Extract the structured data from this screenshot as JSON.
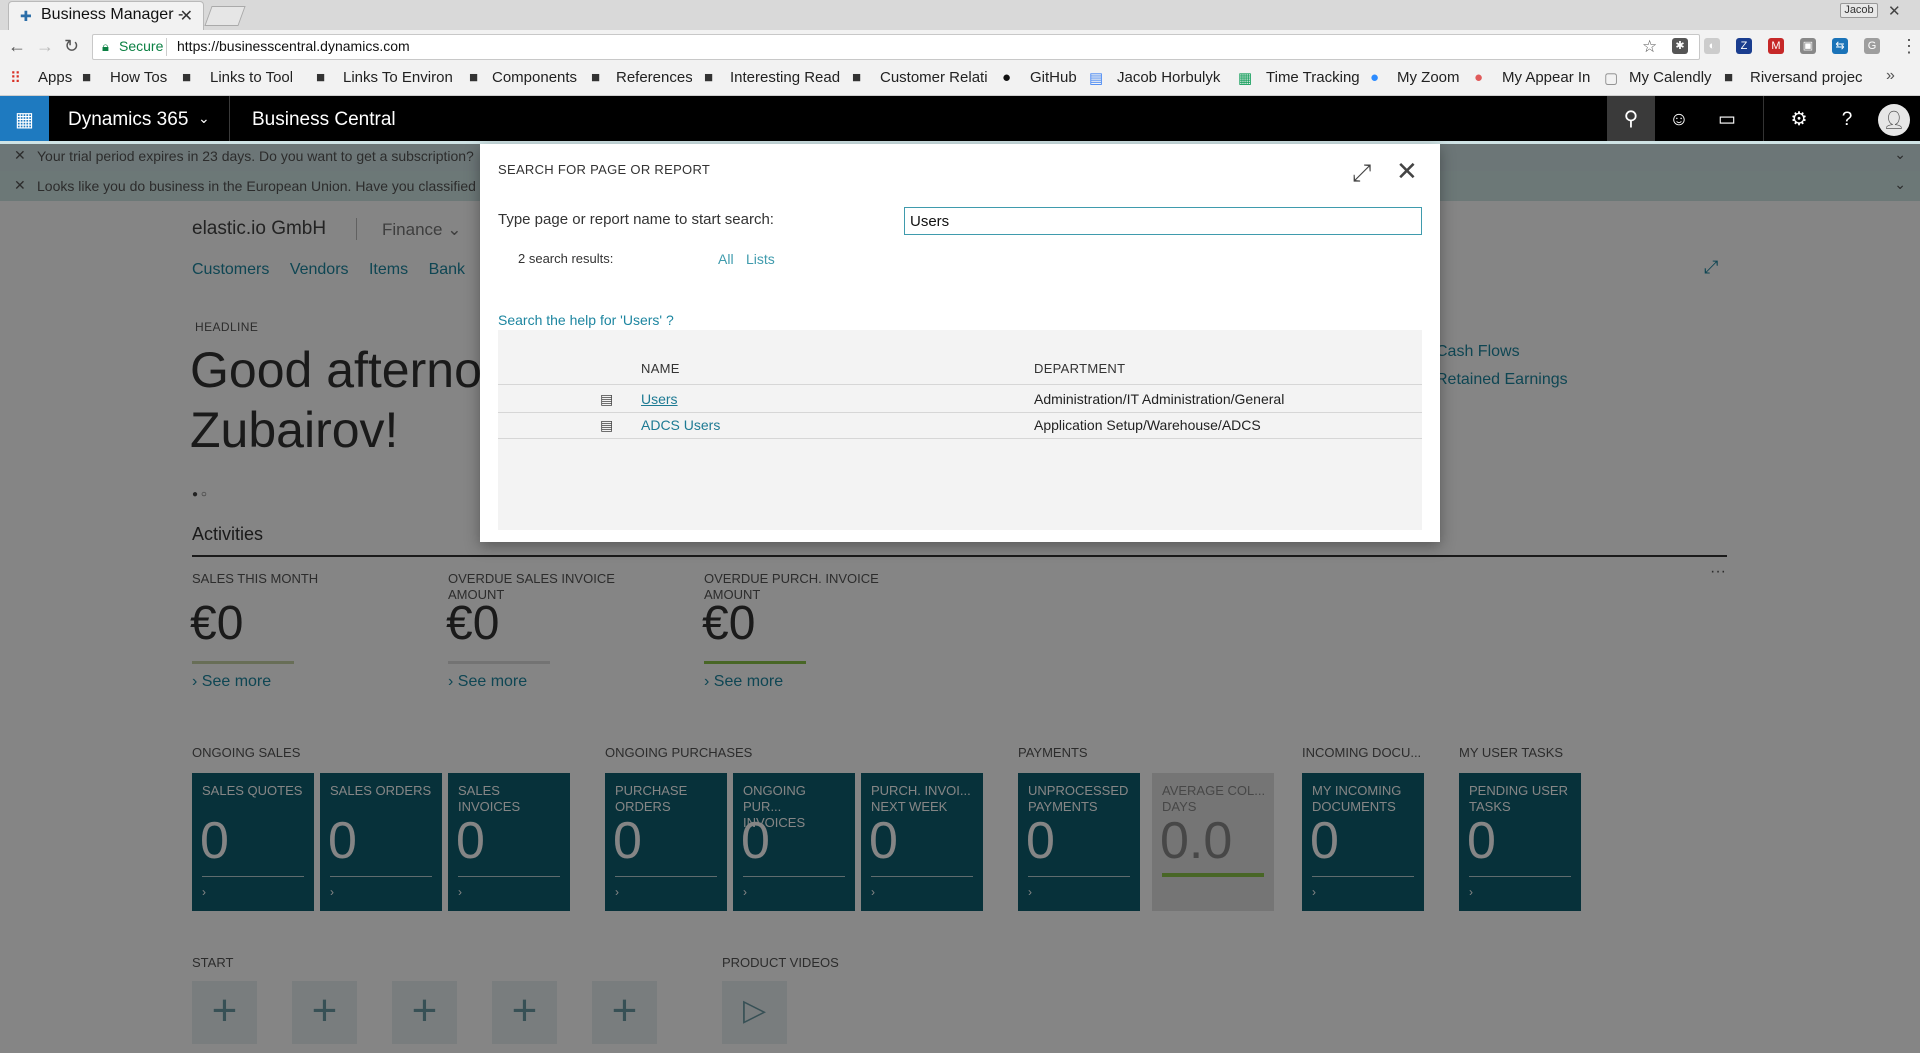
{
  "browser": {
    "tab_title": "Business Manager -",
    "profile": "Jacob",
    "secure_label": "Secure",
    "url": "https://businesscentral.dynamics.com"
  },
  "bookmarks": [
    {
      "label": "Apps",
      "icon": "apps-grid-icon"
    },
    {
      "label": "How Tos",
      "icon": "folder-icon"
    },
    {
      "label": "Links to Tools",
      "icon": "folder-icon"
    },
    {
      "label": "Links To Environ",
      "icon": "folder-icon"
    },
    {
      "label": "Components",
      "icon": "folder-icon"
    },
    {
      "label": "References",
      "icon": "folder-icon"
    },
    {
      "label": "Interesting Read",
      "icon": "folder-icon"
    },
    {
      "label": "Customer Relati",
      "icon": "folder-icon"
    },
    {
      "label": "GitHub",
      "icon": "github-icon"
    },
    {
      "label": "Jacob Horbulyk",
      "icon": "doc-icon"
    },
    {
      "label": "Time Tracking",
      "icon": "sheet-icon"
    },
    {
      "label": "My Zoom",
      "icon": "zoom-icon"
    },
    {
      "label": "My Appear In",
      "icon": "appearin-icon"
    },
    {
      "label": "My Calendly",
      "icon": "calendly-icon"
    },
    {
      "label": "Riversand projec",
      "icon": "folder-icon"
    }
  ],
  "appbar": {
    "product": "Dynamics 365",
    "app": "Business Central"
  },
  "notifications": [
    "Your trial period expires in 23 days. Do you want to get a subscription?",
    "Looks like you do business in the European Union. Have you classified"
  ],
  "dashboard": {
    "company": "elastic.io GmbH",
    "role": "Finance",
    "nav": [
      "Customers",
      "Vendors",
      "Items",
      "Bank"
    ],
    "headline_label": "HEADLINE",
    "headline_line1": "Good afterno",
    "headline_line2": "Zubairov!",
    "right_links": [
      "Cash Flows",
      "Retained Earnings"
    ],
    "activities_title": "Activities",
    "kpis": [
      {
        "label": "SALES THIS MONTH",
        "value": "€0",
        "more": "See more",
        "bar_color": "#c8d4a8"
      },
      {
        "label": "OVERDUE SALES INVOICE AMOUNT",
        "value": "€0",
        "more": "See more",
        "bar_color": "#dcdcdc"
      },
      {
        "label": "OVERDUE PURCH. INVOICE AMOUNT",
        "value": "€0",
        "more": "See more",
        "bar_color": "#8bc34a"
      }
    ],
    "tile_groups": [
      {
        "title": "ONGOING SALES",
        "tiles": [
          {
            "label": "SALES QUOTES",
            "value": "0"
          },
          {
            "label": "SALES ORDERS",
            "value": "0"
          },
          {
            "label": "SALES INVOICES",
            "value": "0"
          }
        ]
      },
      {
        "title": "ONGOING PURCHASES",
        "tiles": [
          {
            "label": "PURCHASE ORDERS",
            "value": "0"
          },
          {
            "label": "ONGOING PUR... INVOICES",
            "value": "0"
          },
          {
            "label": "PURCH. INVOI... NEXT WEEK",
            "value": "0"
          }
        ]
      },
      {
        "title": "PAYMENTS",
        "tiles": [
          {
            "label": "UNPROCESSED PAYMENTS",
            "value": "0"
          },
          {
            "label": "AVERAGE COL... DAYS",
            "value": "0.0"
          }
        ]
      },
      {
        "title": "INCOMING DOCU...",
        "tiles": [
          {
            "label": "MY INCOMING DOCUMENTS",
            "value": "0"
          }
        ]
      },
      {
        "title": "MY USER TASKS",
        "tiles": [
          {
            "label": "PENDING USER TASKS",
            "value": "0"
          }
        ]
      }
    ],
    "start_title": "START",
    "videos_title": "PRODUCT VIDEOS"
  },
  "dialog": {
    "title": "SEARCH FOR PAGE OR REPORT",
    "prompt": "Type page or report name to start search:",
    "search_value": "Users",
    "result_count": "2 search results:",
    "filters": [
      "All",
      "Lists"
    ],
    "help_link": "Search the help for 'Users' ?",
    "columns": {
      "name": "NAME",
      "department": "DEPARTMENT"
    },
    "results": [
      {
        "name": "Users",
        "department": "Administration/IT Administration/General"
      },
      {
        "name": "ADCS Users",
        "department": "Application Setup/Warehouse/ADCS"
      }
    ]
  },
  "colors": {
    "accent": "#1e7ac0",
    "tile": "#0f5f70",
    "link": "#1d86a0"
  }
}
